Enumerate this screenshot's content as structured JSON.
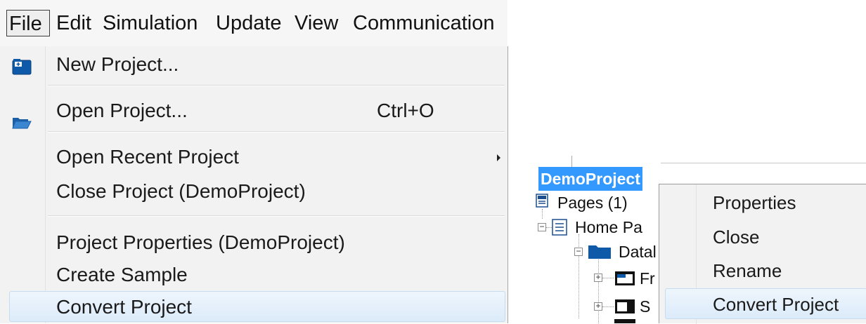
{
  "menubar": {
    "items": [
      "File",
      "Edit",
      "Simulation",
      "Update",
      "View",
      "Communication"
    ]
  },
  "file_menu": {
    "new_project": "New Project...",
    "open_project": "Open Project...",
    "open_project_shortcut": "Ctrl+O",
    "open_recent": "Open Recent Project",
    "close_project": "Close Project (DemoProject)",
    "project_properties": "Project Properties (DemoProject)",
    "create_sample": "Create Sample",
    "convert_project": "Convert Project",
    "icons": {
      "new_project": "new-project-icon",
      "open_project": "folder-open-icon",
      "submenu": "submenu-arrow-icon"
    }
  },
  "tree": {
    "project": "DemoProject",
    "pages": "Pages (1)",
    "home_page": "Home Pa",
    "datal": "Datal",
    "fr": "Fr",
    "s": "S",
    "icons": {
      "pages": "pages-icon",
      "page": "page-icon",
      "folder": "folder-icon",
      "frame": "frame-icon",
      "screen": "screen-icon"
    }
  },
  "context_menu": {
    "items": [
      "Properties",
      "Close",
      "Rename",
      "Convert Project"
    ],
    "highlighted": "Convert Project"
  },
  "colors": {
    "selection_blue": "#3399ff",
    "hover_fill": "#dcebfa",
    "hover_border": "#c6dcf1",
    "menu_bg": "#f2f2f2",
    "icon_blue": "#0f5aa8"
  }
}
